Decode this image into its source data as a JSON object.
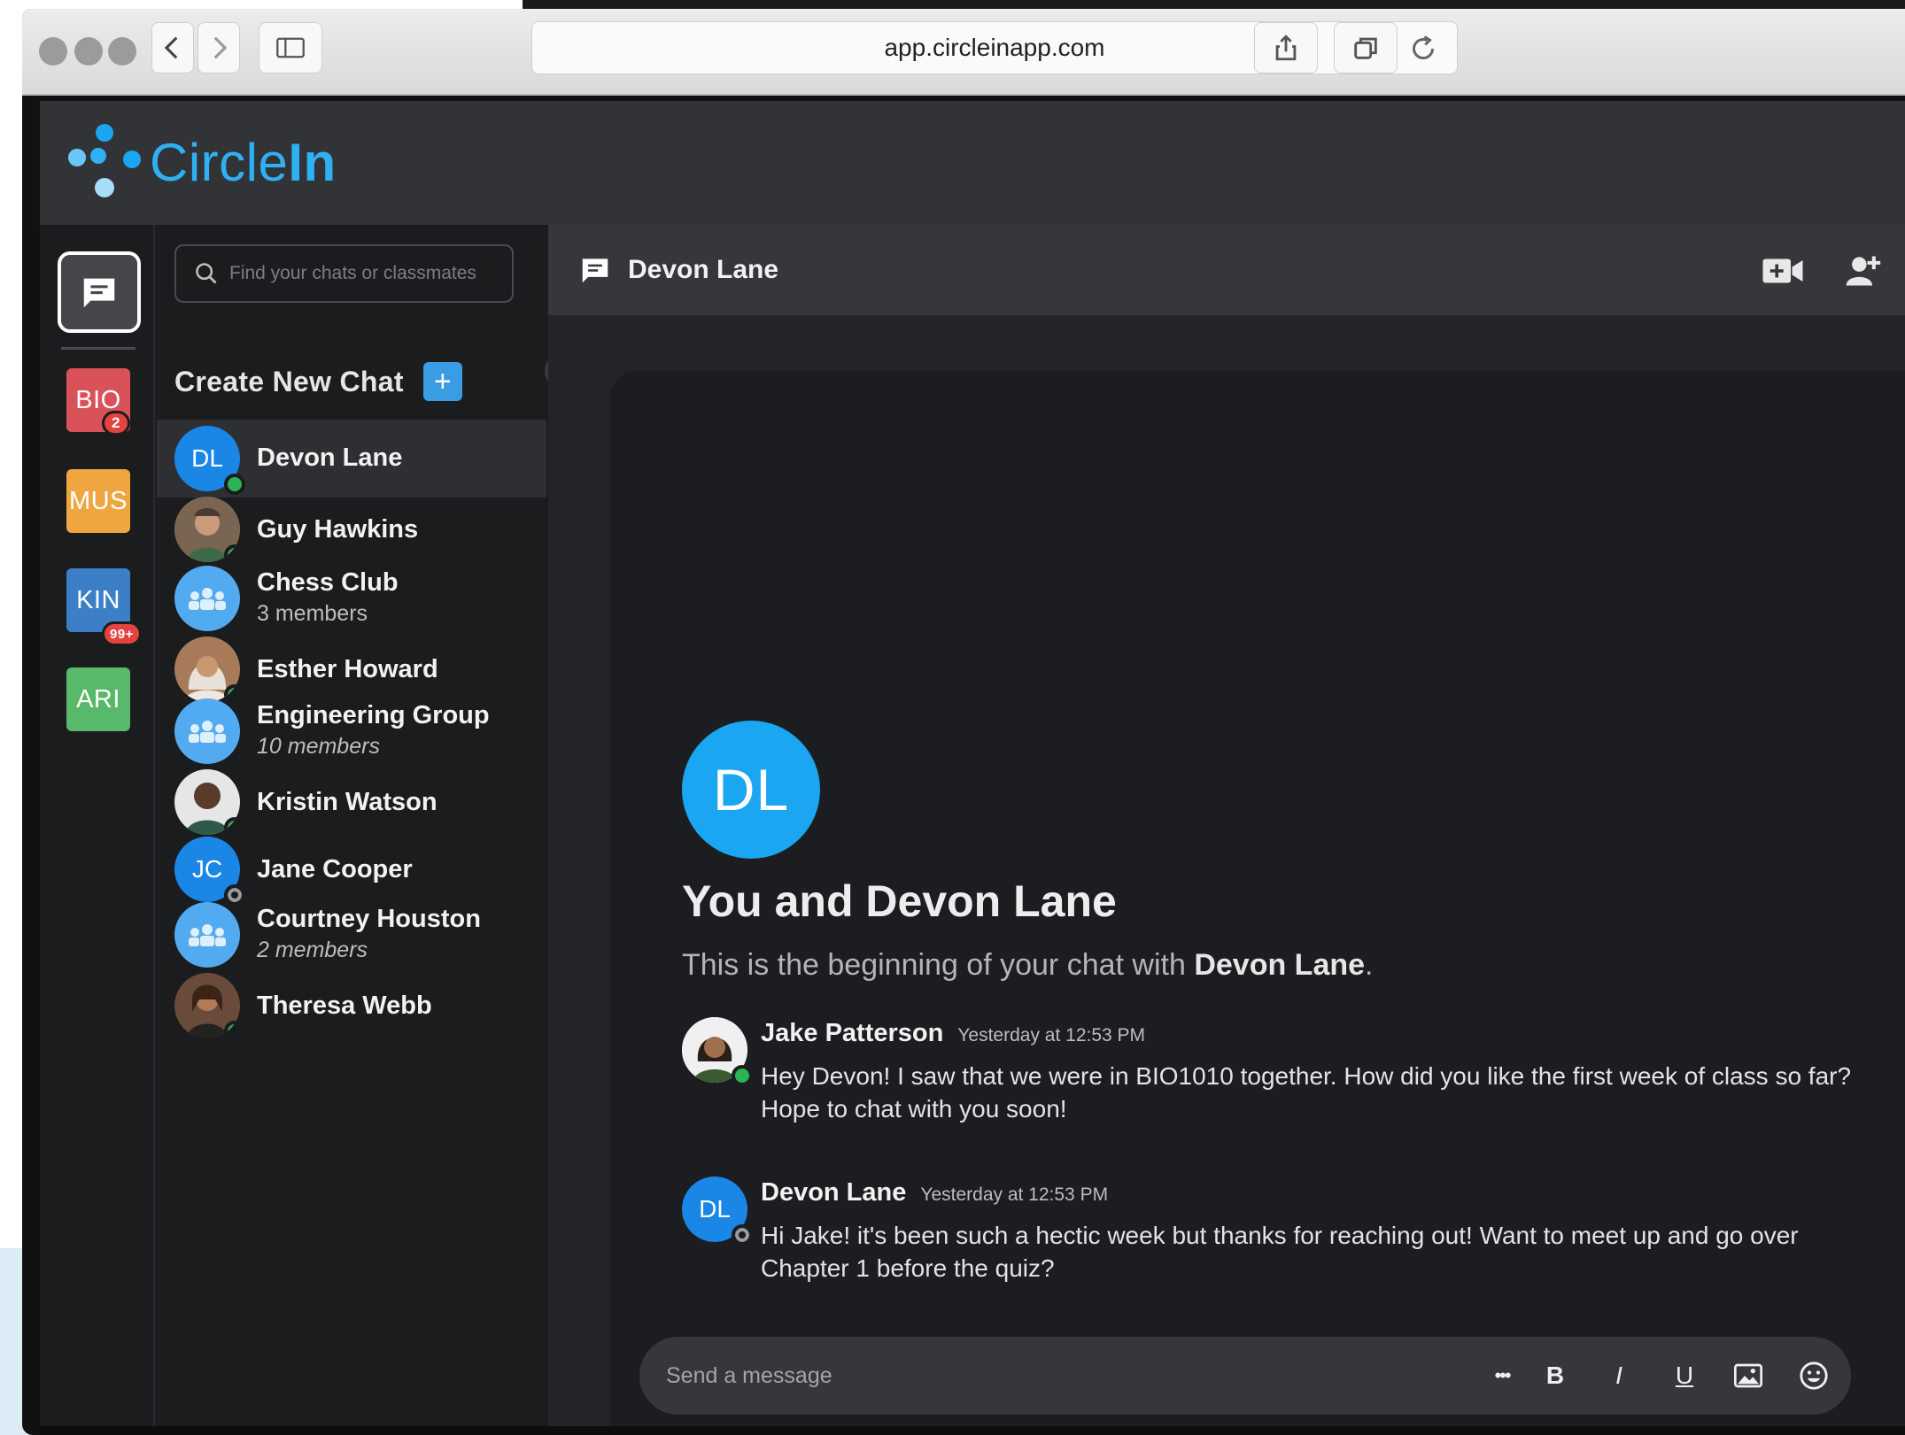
{
  "browser": {
    "url": "app.circleinapp.com"
  },
  "app": {
    "logo_text_light": "Circle",
    "logo_text_bold": "In",
    "brand_color": "#2fb0f2"
  },
  "rail": {
    "classes": [
      {
        "label": "BIO",
        "color": "#d9525a",
        "badge": "2"
      },
      {
        "label": "MUS",
        "color": "#f0a640",
        "badge": ""
      },
      {
        "label": "KIN",
        "color": "#3d7fc7",
        "badge": "99+"
      },
      {
        "label": "ARI",
        "color": "#58b96a",
        "badge": ""
      }
    ]
  },
  "sidebar": {
    "search_placeholder": "Find your chats or classmates",
    "create_label": "Create New Chat",
    "create_icon": "+",
    "chats": [
      {
        "name": "Devon Lane",
        "initials": "DL",
        "sub": "",
        "active": true,
        "online": true
      },
      {
        "name": "Guy Hawkins",
        "initials": "",
        "sub": "",
        "active": false,
        "online": true
      },
      {
        "name": "Chess Club",
        "initials": "",
        "sub": "3 members",
        "active": false,
        "online": false
      },
      {
        "name": "Esther Howard",
        "initials": "",
        "sub": "",
        "active": false,
        "online": true
      },
      {
        "name": "Engineering Group",
        "initials": "",
        "sub": "10 members",
        "active": false,
        "online": false
      },
      {
        "name": "Kristin Watson",
        "initials": "",
        "sub": "",
        "active": false,
        "online": true
      },
      {
        "name": "Jane Cooper",
        "initials": "JC",
        "sub": "",
        "active": false,
        "online": false
      },
      {
        "name": "Courtney Houston",
        "initials": "",
        "sub": "2 members",
        "active": false,
        "online": false
      },
      {
        "name": "Theresa Webb",
        "initials": "",
        "sub": "",
        "active": false,
        "online": true
      }
    ]
  },
  "chat": {
    "title": "Devon Lane",
    "intro_initials": "DL",
    "intro_title": "You and Devon Lane",
    "intro_sub_prefix": "This is the beginning of your chat with ",
    "intro_sub_name": "Devon Lane",
    "intro_sub_suffix": ".",
    "messages": [
      {
        "author": "Jake Patterson",
        "time": "Yesterday at 12:53 PM",
        "initials": "",
        "text": "Hey Devon! I saw that we were in BIO1010 together. How did you like the first week of class so far? Hope to chat with you soon!"
      },
      {
        "author": "Devon Lane",
        "time": "Yesterday at 12:53 PM",
        "initials": "DL",
        "text": "Hi Jake! it's been such a hectic week but thanks for reaching out! Want to meet up and go over Chapter 1 before the quiz?"
      }
    ],
    "composer_placeholder": "Send a message",
    "tools": {
      "more": "•••",
      "bold": "B",
      "italic": "I",
      "underline": "U"
    }
  }
}
